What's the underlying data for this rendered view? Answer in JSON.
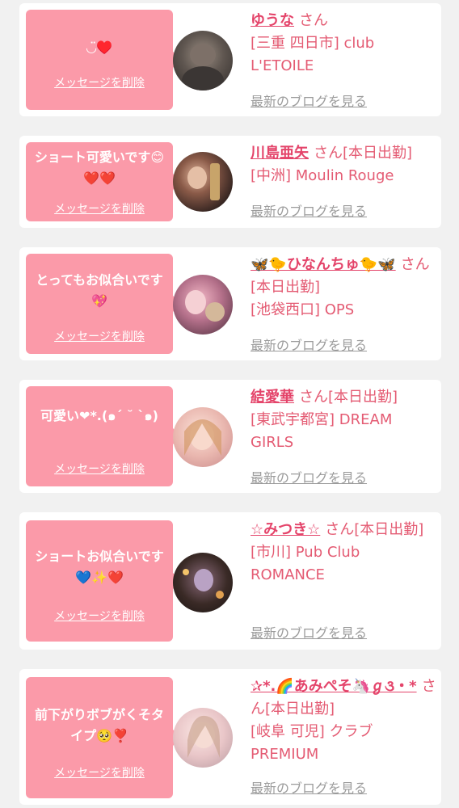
{
  "delete_label": "メッセージを削除",
  "blog_label": "最新のブログを見る",
  "san": "さん",
  "colors": {
    "bubble": "#fb9aa9",
    "accent": "#e4446a",
    "link_gray": "#9b9b9b",
    "background": "#f1f1f1"
  },
  "cards": [
    {
      "message": "◡̈♥️",
      "name": "ゆうな",
      "suffix": "さん",
      "shop": "[三重 四日市] club L'ETOILE",
      "avatar": "avatar-photo-gray"
    },
    {
      "message": "ショート可愛いです😊❤️❤️",
      "name": "川島亜矢",
      "suffix": "さん[本日出勤]",
      "shop": "[中洲] Moulin Rouge",
      "avatar": "avatar-photo-dark"
    },
    {
      "message": "とってもお似合いです💖",
      "name": "🦋🐤ひなんちゅ🐤🦋",
      "suffix": "さん[本日出勤]",
      "shop": "[池袋西口] OPS",
      "avatar": "avatar-photo-pink"
    },
    {
      "message": "可愛い❤*.(๑ˊ ˘ ˋ๑)",
      "name": "結愛華",
      "suffix": "さん[本日出勤]",
      "shop": "[東武宇都宮] DREAM GIRLS",
      "avatar": "avatar-photo-light"
    },
    {
      "message": "ショートお似合いです💙✨❤️",
      "name": "☆みつき☆",
      "suffix": "さん[本日出勤]",
      "shop": "[市川] Pub Club ROMANCE",
      "avatar": "avatar-photo-night"
    },
    {
      "message": "前下がりボブがくそタイプ🥺❣️",
      "name": "✰*.🌈あみぺそ🦄ℊ૩・*",
      "suffix": "さん[本日出勤]",
      "shop": "[岐阜 可児] クラブ PREMIUM",
      "avatar": "avatar-photo-pale"
    }
  ]
}
